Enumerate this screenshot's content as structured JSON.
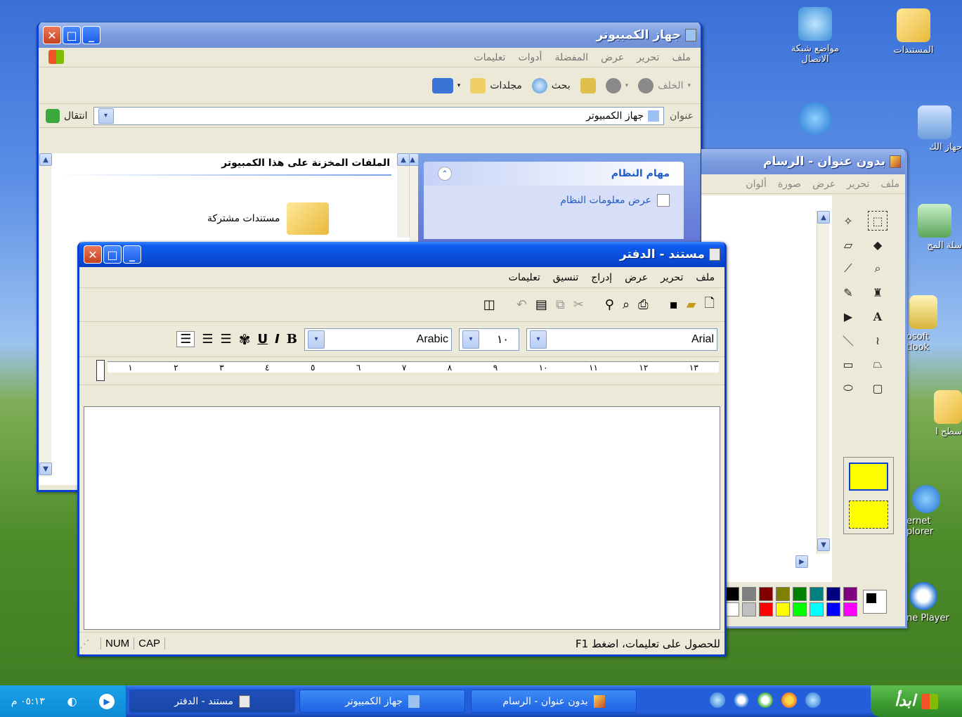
{
  "desktop": {
    "icons": [
      {
        "label": "المستندات"
      },
      {
        "label": "مواضع شبكة الاتصال"
      },
      {
        "label": "جهاز الك"
      },
      {
        "label": "سلة المح"
      },
      {
        "label": "osoft"
      },
      {
        "label": "tlook"
      },
      {
        "label": "سطح ا"
      },
      {
        "label": "ernet"
      },
      {
        "label": "plorer"
      },
      {
        "label": "ne Player"
      }
    ]
  },
  "explorer": {
    "title": "جهاز الكمبيوتر",
    "menu": [
      "ملف",
      "تحرير",
      "عرض",
      "المفضلة",
      "أدوات",
      "تعليمات"
    ],
    "back_label": "الخلف",
    "search_label": "بحث",
    "folders_label": "مجلدات",
    "address_label": "عنوان",
    "address_value": "جهاز الكمبيوتر",
    "go_label": "انتقال",
    "section_heading": "الملفات المخزنة على هذا الكمبيوتر",
    "shared_docs": "مستندات مشتركة",
    "tasks_heading": "مهام النظام",
    "task_view_info": "عرض معلومات النظام"
  },
  "paint": {
    "title": "بدون عنوان - الرسام",
    "menu": [
      "ملف",
      "تحرير",
      "عرض",
      "صورة",
      "ألوان"
    ],
    "palette": [
      "#000000",
      "#808080",
      "#800000",
      "#808000",
      "#008000",
      "#008080",
      "#000080",
      "#800080",
      "#ffffff",
      "#c0c0c0",
      "#ff0000",
      "#ffff00",
      "#00ff00",
      "#00ffff",
      "#0000ff",
      "#ff00ff"
    ]
  },
  "wordpad": {
    "title": "مستند - الدفتر",
    "menu": [
      "ملف",
      "تحرير",
      "عرض",
      "إدراج",
      "تنسيق",
      "تعليمات"
    ],
    "font_name": "Arial",
    "font_size": "١٠",
    "script": "Arabic",
    "ruler": [
      "١",
      "٢",
      "٣",
      "٤",
      "٥",
      "٦",
      "٧",
      "٨",
      "٩",
      "١٠",
      "١١",
      "١٢",
      "١٣"
    ],
    "status_help": "للحصول على تعليمات، اضغط F1",
    "status_num": "NUM",
    "status_cap": "CAP"
  },
  "taskbar": {
    "start_label": "ابدأ",
    "tasks": [
      {
        "label": "بدون عنوان - الرسام"
      },
      {
        "label": "جهاز الكمبيوتر"
      },
      {
        "label": "مستند - الدفتر"
      }
    ],
    "clock": "٠٥:١٣ م"
  }
}
